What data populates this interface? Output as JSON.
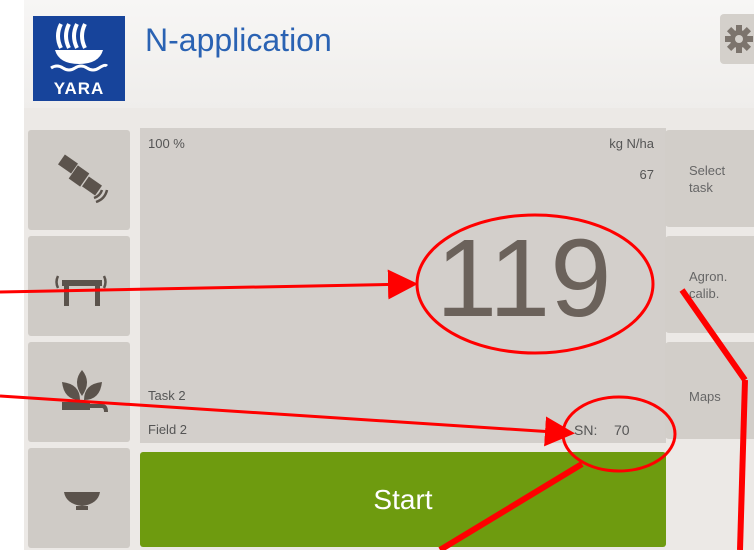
{
  "header": {
    "title": "N-application",
    "logo_text": "YARA"
  },
  "sidebar": {
    "items": [
      {
        "icon": "satellite-icon"
      },
      {
        "icon": "sensor-boom-icon"
      },
      {
        "icon": "plant-icon"
      },
      {
        "icon": "bowl-icon"
      }
    ]
  },
  "display": {
    "percent": "100 %",
    "unit": "kg N/ha",
    "target_value": "67",
    "rate_value": "119",
    "task_label": "Task 2",
    "field_label": "Field 2",
    "sn_label": "SN:",
    "sn_value": "70"
  },
  "actions": {
    "start_label": "Start"
  },
  "right_menu": {
    "items": [
      {
        "label": "Select\ntask"
      },
      {
        "label": "Agron.\ncalib."
      },
      {
        "label": "Maps"
      }
    ]
  },
  "colors": {
    "brand_blue": "#17449b",
    "title_blue": "#2a62b3",
    "start_green": "#6e9b0f",
    "annotation_red": "#ff0000"
  }
}
